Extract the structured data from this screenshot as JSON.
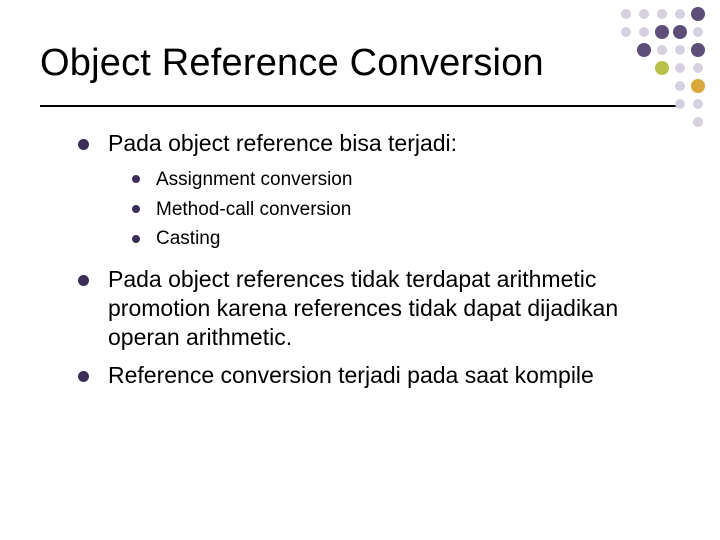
{
  "title": "Object Reference Conversion",
  "bullets": {
    "b1": "Pada object reference bisa terjadi:",
    "sub": {
      "s1": "Assignment conversion",
      "s2": "Method-call conversion",
      "s3": "Casting"
    },
    "b2": "Pada object references tidak terdapat arithmetic promotion karena references tidak dapat dijadikan operan arithmetic.",
    "b3": "Reference conversion terjadi pada saat kompile"
  }
}
